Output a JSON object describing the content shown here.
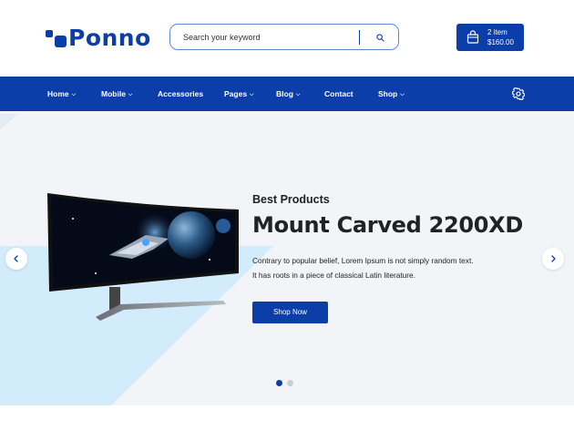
{
  "brand": {
    "name": "Ponno",
    "color": "#0b3ea8"
  },
  "search": {
    "placeholder": "Search your keyword",
    "icon": "search-icon"
  },
  "cart": {
    "items": "2 item",
    "total": "$160.00",
    "icon": "shopping-bag-icon"
  },
  "nav": {
    "items": [
      {
        "label": "Home",
        "dropdown": true
      },
      {
        "label": "Mobile",
        "dropdown": true
      },
      {
        "label": "Accessories",
        "dropdown": false
      },
      {
        "label": "Pages",
        "dropdown": true
      },
      {
        "label": "Blog",
        "dropdown": true
      },
      {
        "label": "Contact",
        "dropdown": false
      },
      {
        "label": "Shop",
        "dropdown": true
      }
    ],
    "settings_icon": "gear-icon"
  },
  "hero": {
    "subtitle": "Best Products",
    "title": "Mount Carved 2200XD",
    "description": [
      "Contrary to popular belief, Lorem Ipsum is not simply random text.",
      "It has roots in a piece of classical Latin literature."
    ],
    "button_label": "Shop Now",
    "prev_icon": "chevron-left-icon",
    "next_icon": "chevron-right-icon",
    "slides_count": 2,
    "active_slide": 1
  },
  "colors": {
    "primary": "#0b3ea8",
    "hero_bg": "#f2f4f7",
    "accent_shape": "#d2ecfb"
  }
}
